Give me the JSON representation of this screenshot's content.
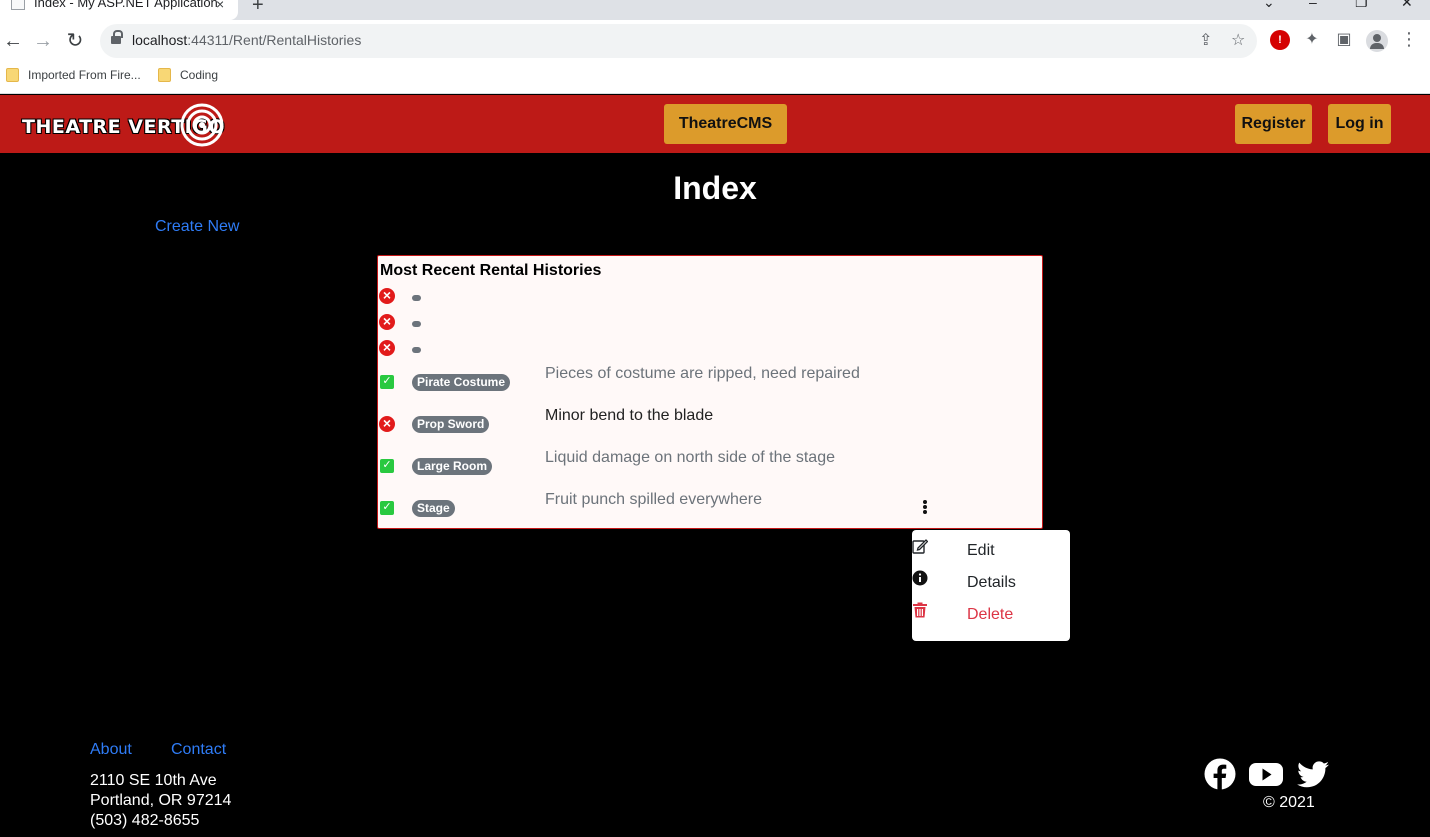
{
  "browser": {
    "tab_title": "Index - My ASP.NET Application",
    "tab_close": "×",
    "new_tab": "+",
    "url_host": "localhost",
    "url_path": ":44311/Rent/RentalHistories",
    "bookmarks": [
      "Imported From Fire...",
      "Coding"
    ],
    "icons": [
      "back-arrow-icon",
      "forward-arrow-icon",
      "reload-icon",
      "lock-icon",
      "share-icon",
      "star-icon",
      "extension-icon",
      "puzzle-icon",
      "sidebar-icon",
      "profile-icon",
      "menu-icon"
    ]
  },
  "header": {
    "logo_text": "THEATRE VERTIGO",
    "center_button": "TheatreCMS",
    "register": "Register",
    "login": "Log in",
    "colors": {
      "bar": "#bd1a17",
      "button": "#dc9b2b"
    }
  },
  "main": {
    "title": "Index",
    "create_new": "Create New",
    "panel_title": "Most Recent Rental Histories",
    "rows": [
      {
        "status": "damaged",
        "item": "",
        "description": ""
      },
      {
        "status": "damaged",
        "item": "",
        "description": ""
      },
      {
        "status": "damaged",
        "item": "",
        "description": ""
      },
      {
        "status": "ok",
        "item": "Pirate Costume",
        "description": "Pieces of costume are ripped, need repaired"
      },
      {
        "status": "damaged",
        "item": "Prop Sword",
        "description": "Minor bend to the blade"
      },
      {
        "status": "ok",
        "item": "Large Room",
        "description": "Liquid damage on north side of the stage"
      },
      {
        "status": "ok",
        "item": "Stage",
        "description": "Fruit punch spilled everywhere"
      }
    ],
    "dropdown": {
      "edit": "Edit",
      "details": "Details",
      "delete": "Delete"
    }
  },
  "footer": {
    "about": "About",
    "contact": "Contact",
    "address_line1": "2110 SE 10th Ave",
    "address_line2": "Portland, OR 97214",
    "phone": "(503) 482-8655",
    "copyright": "© 2021",
    "social_icons": [
      "facebook-icon",
      "youtube-icon",
      "twitter-icon"
    ]
  }
}
